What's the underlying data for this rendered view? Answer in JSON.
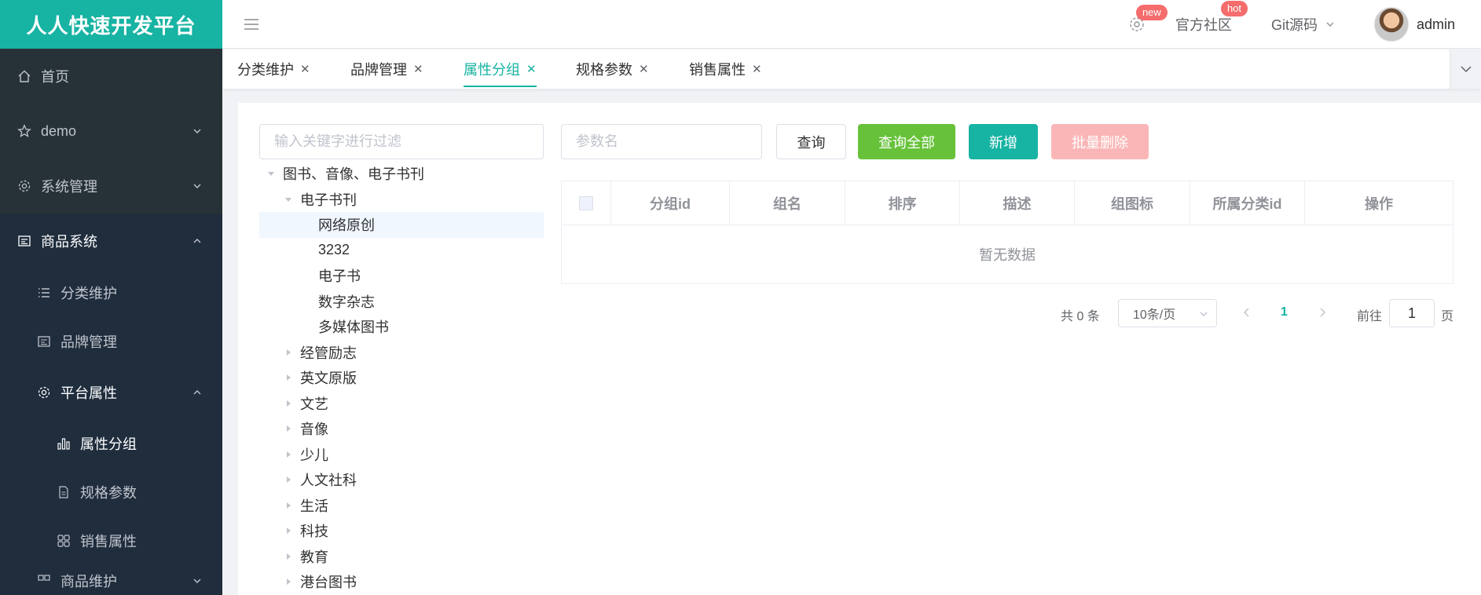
{
  "app": {
    "title": "人人快速开发平台"
  },
  "sidebar": {
    "items": [
      {
        "label": "首页",
        "icon": "home-icon"
      },
      {
        "label": "demo",
        "icon": "star-icon"
      },
      {
        "label": "系统管理",
        "icon": "gear-icon"
      },
      {
        "label": "商品系统",
        "icon": "list-icon"
      }
    ],
    "product_children": [
      {
        "label": "分类维护",
        "icon": "menu-list-icon"
      },
      {
        "label": "品牌管理",
        "icon": "card-icon"
      },
      {
        "label": "平台属性",
        "icon": "gear-icon"
      }
    ],
    "attr_children": [
      {
        "label": "属性分组",
        "icon": "bar-chart-icon"
      },
      {
        "label": "规格参数",
        "icon": "document-icon"
      },
      {
        "label": "销售属性",
        "icon": "grid-icon"
      }
    ],
    "cut_item": {
      "label": "商品维护"
    }
  },
  "header": {
    "badge_new": "new",
    "community": "官方社区",
    "badge_hot": "hot",
    "git": "Git源码",
    "user": "admin"
  },
  "tabs": [
    {
      "label": "分类维护"
    },
    {
      "label": "品牌管理"
    },
    {
      "label": "属性分组"
    },
    {
      "label": "规格参数"
    },
    {
      "label": "销售属性"
    }
  ],
  "filter": {
    "placeholder": "输入关键字进行过滤"
  },
  "tree": {
    "root": "图书、音像、电子书刊",
    "child": "电子书刊",
    "leaves": [
      "网络原创",
      "3232",
      "电子书",
      "数字杂志",
      "多媒体图书"
    ],
    "siblings": [
      "经管励志",
      "英文原版",
      "文艺",
      "音像",
      "少儿",
      "人文社科",
      "生活",
      "科技",
      "教育",
      "港台图书"
    ]
  },
  "search": {
    "placeholder": "参数名"
  },
  "buttons": {
    "query": "查询",
    "query_all": "查询全部",
    "add": "新增",
    "batch_delete": "批量删除"
  },
  "table": {
    "headers": [
      "分组id",
      "组名",
      "排序",
      "描述",
      "组图标",
      "所属分类id",
      "操作"
    ],
    "empty": "暂无数据"
  },
  "pagination": {
    "total": "共 0 条",
    "page_size": "10条/页",
    "current": "1",
    "goto": "前往",
    "jump": "1",
    "unit": "页"
  },
  "colors": {
    "accent": "#17b3a3",
    "sidebar": "#263238",
    "success": "#67c23a",
    "danger_light": "#fab6b6"
  }
}
